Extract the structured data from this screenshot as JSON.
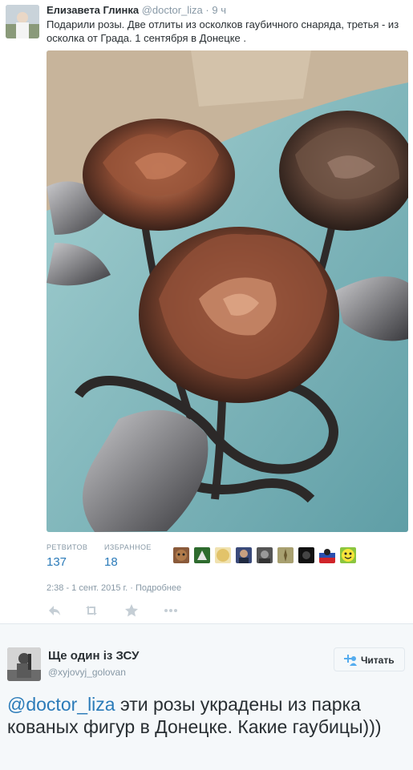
{
  "tweet1": {
    "name": "Елизавета Глинка",
    "handle": "@doctor_liza",
    "separator": "·",
    "time": "9 ч",
    "text": "Подарили розы. Две отлиты из осколков гаубичного снаряда, третья - из осколка от Града. 1 сентября в Донецке .",
    "stats": {
      "retweets_label": "РЕТВИТОВ",
      "retweets_count": "137",
      "favorites_label": "ИЗБРАННОЕ",
      "favorites_count": "18"
    },
    "timestamp": "2:38 - 1 сент. 2015 г.",
    "meta_sep": " · ",
    "details_link": "Подробнее",
    "actions": [
      "reply-icon",
      "retweet-icon",
      "favorite-icon",
      "more-icon"
    ],
    "favoriter_avatars": 9
  },
  "tweet2": {
    "name": "Ще один із ЗСУ",
    "handle": "@xyjovyj_golovan",
    "follow_label": "Читать",
    "mention": "@doctor_liza",
    "text": " эти розы украдены из парка кованых фигур в Донецке. Какие гаубицы)))"
  },
  "colors": {
    "link": "#2b7bb9",
    "muted": "#8899a6",
    "text": "#292f33",
    "photo_bg": "#7fb3b8",
    "copper": "#a8684a"
  }
}
